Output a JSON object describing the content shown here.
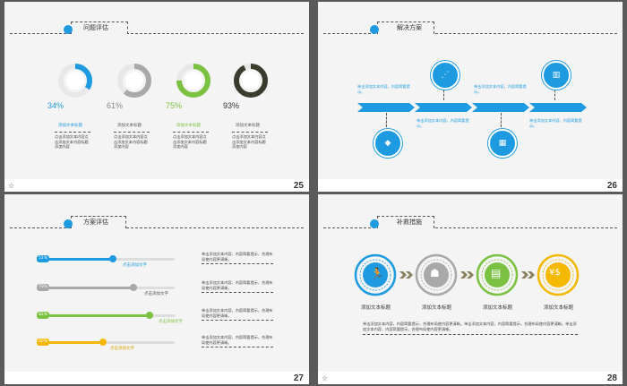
{
  "slides": [
    {
      "number": "25",
      "title": "问题评估",
      "items": [
        {
          "percent": "34%",
          "value": 34,
          "color": "#1e9be0",
          "caption": "添加文本标题",
          "text": "点击添加文本内容点击添加文本内容标题添加内容"
        },
        {
          "percent": "61%",
          "value": 61,
          "color": "#a9a9a9",
          "caption": "添加文本标题",
          "text": "点击添加文本内容点击添加文本内容标题添加内容"
        },
        {
          "percent": "75%",
          "value": 75,
          "color": "#7cc242",
          "caption": "添加文本标题",
          "text": "点击添加文本内容点击添加文本内容标题添加内容"
        },
        {
          "percent": "93%",
          "value": 93,
          "color": "#3b3b2e",
          "caption": "添加文本标题",
          "text": "点击添加文本内容点击添加文本内容标题添加内容"
        }
      ]
    },
    {
      "number": "26",
      "title": "解决方案",
      "texts": [
        "单击添加文本内容，内容简要提示。",
        "单击添加文本内容，内容简要提示。",
        "单击添加文本内容，内容简要提示。",
        "单击添加文本内容，内容简要提示。"
      ]
    },
    {
      "number": "27",
      "title": "方案评估",
      "bars": [
        {
          "label": "51%",
          "value": 51,
          "color": "#1e9be0",
          "caption": "点击添加文字",
          "text": "单击添加文本内容，内容简要提示，合理布局使内容更清晰。"
        },
        {
          "label": "70%",
          "value": 70,
          "color": "#a9a9a9",
          "caption": "点击添加文字",
          "text": "单击添加文本内容，内容简要提示，合理布局使内容更清晰。"
        },
        {
          "label": "82%",
          "value": 82,
          "color": "#7cc242",
          "caption": "点击添加文字",
          "text": "单击添加文本内容，内容简要提示，合理布局使内容更清晰。"
        },
        {
          "label": "40%",
          "value": 40,
          "color": "#f5b800",
          "caption": "点击添加文字",
          "text": "单击添加文本内容，内容简要提示，合理布局使内容更清晰。"
        }
      ]
    },
    {
      "number": "28",
      "title": "补救措施",
      "steps": [
        {
          "label": "添加文本标题",
          "color": "#1e9be0",
          "icon": "runner-icon"
        },
        {
          "label": "添加文本标题",
          "color": "#a9a9a9",
          "icon": "presenter-icon"
        },
        {
          "label": "添加文本标题",
          "color": "#7cc242",
          "icon": "growth-chart-icon"
        },
        {
          "label": "添加文本标题",
          "color": "#f5b800",
          "icon": "coins-icon"
        }
      ],
      "body_text": "单击添加文本内容，内容简要提示，合理布局使内容更清晰。单击添加文本内容，内容简要提示，合理布局使内容更清晰。单击添加文本内容，内容简要提示，合理布局使内容更清晰。"
    }
  ],
  "footer_icon": "star-icon",
  "colors": {
    "accent": "#1e9be0",
    "gray": "#a9a9a9",
    "green": "#7cc242",
    "yellow": "#f5b800",
    "dark": "#3b3b2e",
    "arrow": "#8b8060"
  }
}
